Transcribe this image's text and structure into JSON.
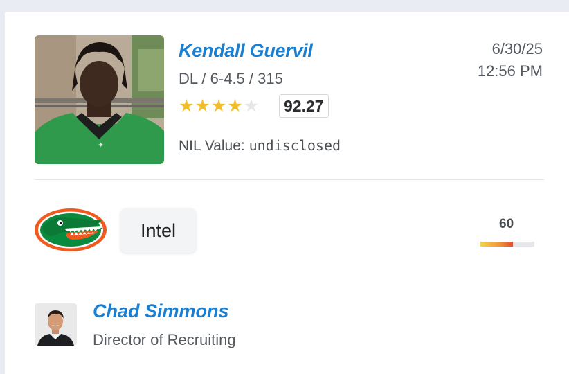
{
  "player": {
    "name": "Kendall Guervil",
    "meta": "DL / 6-4.5 / 315",
    "stars_filled": 4,
    "stars_total": 5,
    "rating": "92.27",
    "nil_label": "NIL Value:",
    "nil_value": "undisclosed"
  },
  "timestamp": {
    "date": "6/30/25",
    "time": "12:56 PM"
  },
  "prediction": {
    "team_logo_icon": "florida-gators-logo-icon",
    "button_label": "Intel",
    "confidence": "60",
    "confidence_fraction": 0.6
  },
  "author": {
    "name": "Chad Simmons",
    "title": "Director of Recruiting"
  },
  "colors": {
    "accent_blue": "#1a7fd0",
    "star_gold": "#f1bd2b",
    "gators_orange": "#f05a1f",
    "gators_green": "#0a8a3e"
  }
}
